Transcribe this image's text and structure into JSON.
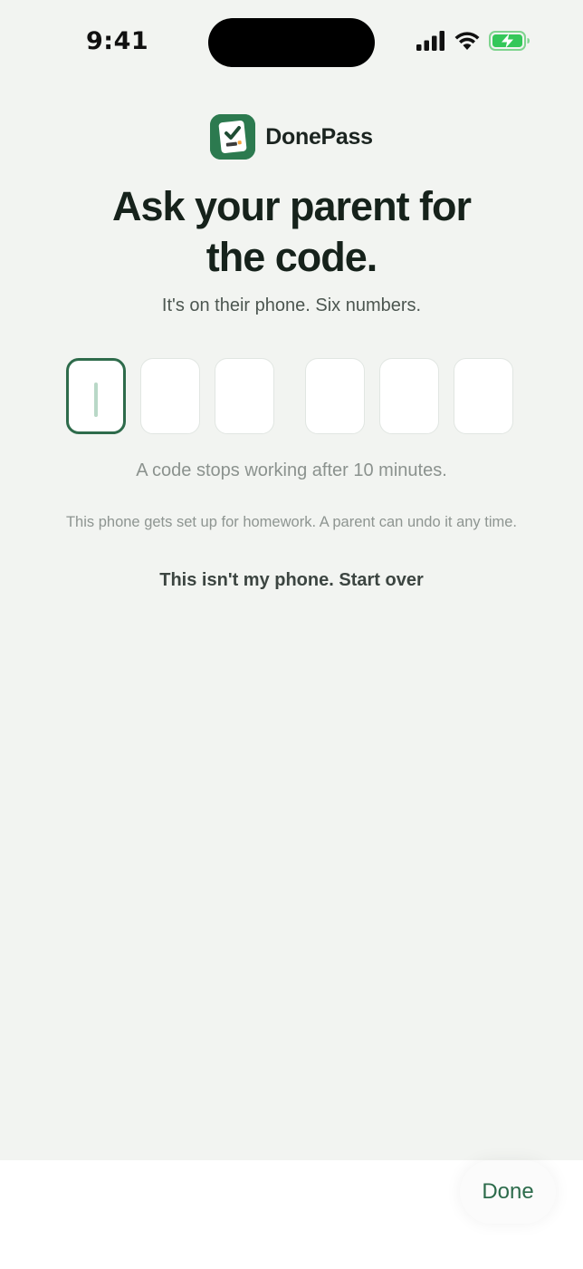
{
  "status_bar": {
    "time": "9:41"
  },
  "brand": {
    "name": "DonePass",
    "icon": "checklist-app-icon",
    "color": "#2c7a4f"
  },
  "title": {
    "line1": "Ask your parent for",
    "line2": "the code."
  },
  "subtitle": "It's on their phone. Six numbers.",
  "code_input": {
    "digits": [
      "",
      "",
      "",
      "",
      "",
      ""
    ],
    "active_index": 0
  },
  "expiry_note": "A code stops working after 10 minutes.",
  "setup_note": "This phone gets set up for homework. A parent can undo it any time.",
  "start_over_link": "This isn't my phone. Start over",
  "keyboard_toolbar": {
    "done_label": "Done"
  },
  "colors": {
    "accent": "#2e6b4b",
    "background": "#f2f4f1",
    "battery": "#34c759"
  }
}
